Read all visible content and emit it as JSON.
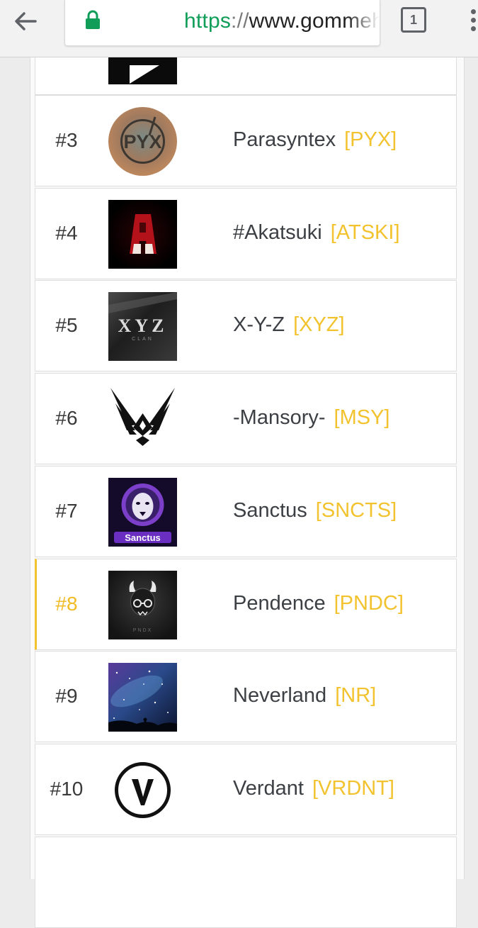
{
  "browser": {
    "url_scheme": "https",
    "url_separator": "://",
    "url_host": "www.gommehd.net",
    "tab_count": "1"
  },
  "leaderboard": {
    "rows": [
      {
        "rank": "",
        "name": "",
        "tag": "",
        "logo": "play-icon"
      },
      {
        "rank": "#3",
        "name": "Parasyntex",
        "tag": "[PYX]",
        "logo_text": "PYX"
      },
      {
        "rank": "#4",
        "name": "#Akatsuki",
        "tag": "[ATSKI]",
        "logo": "akatsuki-logo"
      },
      {
        "rank": "#5",
        "name": "X-Y-Z",
        "tag": "[XYZ]",
        "logo_text": "XYZ",
        "logo_subtext": "CLAN"
      },
      {
        "rank": "#6",
        "name": "-Mansory-",
        "tag": "[MSY]",
        "logo": "wings-emblem"
      },
      {
        "rank": "#7",
        "name": "Sanctus",
        "tag": "[SNCTS]",
        "logo_text": "Sanctus"
      },
      {
        "rank": "#8",
        "name": "Pendence",
        "tag": "[PNDC]",
        "logo_text": "PNDX"
      },
      {
        "rank": "#9",
        "name": "Neverland",
        "tag": "[NR]",
        "logo": "galaxy-image"
      },
      {
        "rank": "#10",
        "name": "Verdant",
        "tag": "[VRDNT]",
        "logo": "verdant-v-logo"
      }
    ]
  },
  "colors": {
    "accent": "#f2c32e",
    "rank_text": "#3a3a3a",
    "name_text": "#3c3f44",
    "secure_green": "#0f9d58"
  }
}
